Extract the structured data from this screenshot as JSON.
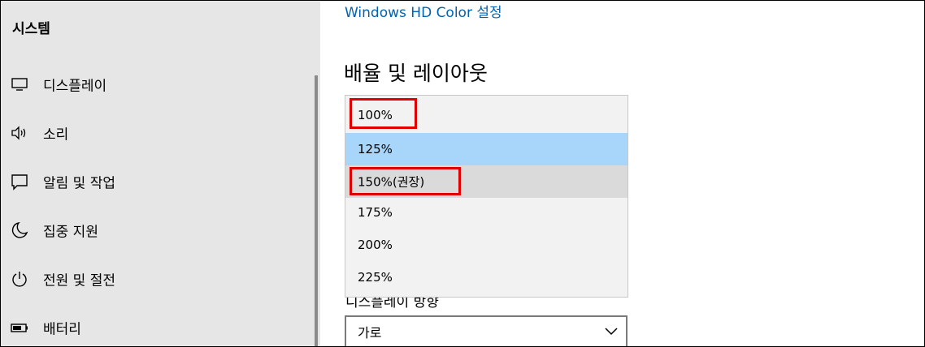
{
  "sidebar": {
    "title": "시스템",
    "items": [
      {
        "label": "디스플레이",
        "icon": "monitor-icon"
      },
      {
        "label": "소리",
        "icon": "speaker-icon"
      },
      {
        "label": "알림 및 작업",
        "icon": "notification-icon"
      },
      {
        "label": "집중 지원",
        "icon": "moon-icon"
      },
      {
        "label": "전원 및 절전",
        "icon": "power-icon"
      },
      {
        "label": "배터리",
        "icon": "battery-icon"
      }
    ]
  },
  "main": {
    "hd_color_link": "Windows HD Color 설정",
    "section_heading": "배율 및 레이아웃",
    "orientation_label": "디스플레이 방향",
    "orientation_value": "가로",
    "scale_options": [
      {
        "label": "100%"
      },
      {
        "label": "125%"
      },
      {
        "label": "150%(권장)"
      },
      {
        "label": "175%"
      },
      {
        "label": "200%"
      },
      {
        "label": "225%"
      }
    ],
    "selected_scale": "125%"
  },
  "annotation_color": "#e00000"
}
